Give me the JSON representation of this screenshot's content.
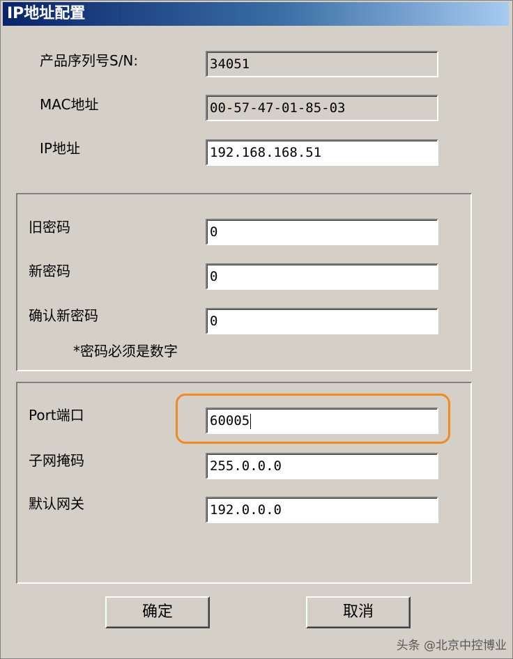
{
  "window": {
    "title": "IP地址配置"
  },
  "device": {
    "serial_label": "产品序列号S/N:",
    "serial_value": "34051",
    "mac_label": "MAC地址",
    "mac_value": "00-57-47-01-85-03",
    "ip_label": "IP地址",
    "ip_value": "192.168.168.51"
  },
  "password": {
    "old_label": "旧密码",
    "old_value": "0",
    "new_label": "新密码",
    "new_value": "0",
    "confirm_label": "确认新密码",
    "confirm_value": "0",
    "note": "*密码必须是数字"
  },
  "network": {
    "port_label": "Port端口",
    "port_value": "60005",
    "subnet_label": "子网掩码",
    "subnet_value": "255.0.0.0",
    "gateway_label": "默认网关",
    "gateway_value": "192.0.0.0"
  },
  "buttons": {
    "ok": "确定",
    "cancel": "取消"
  },
  "watermark": "头条 @北京中控博业",
  "colors": {
    "highlight": "#f08a24",
    "titlebar": "#0a246a"
  }
}
